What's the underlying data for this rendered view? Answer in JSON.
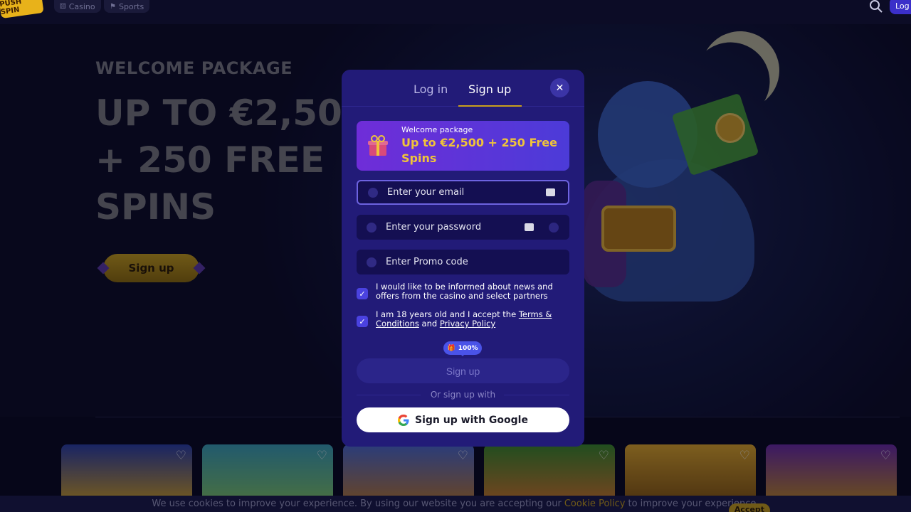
{
  "topbar": {
    "logo_text": "PUSH SPIN",
    "nav": [
      {
        "label": "Casino",
        "icon": "dice-icon"
      },
      {
        "label": "Sports",
        "icon": "trophy-icon"
      }
    ],
    "login_label": "Log"
  },
  "hero": {
    "subtitle": "WELCOME PACKAGE",
    "title": "UP TO €2,50\n+ 250 FREE\nSPINS",
    "signup_label": "Sign up"
  },
  "modal": {
    "tabs": [
      "Log in",
      "Sign up"
    ],
    "active_tab": "Sign up",
    "banner": {
      "small": "Welcome package",
      "big": "Up to €2,500 + 250 Free Spins"
    },
    "email_placeholder": "Enter your email",
    "password_placeholder": "Enter your password",
    "promo_placeholder": "Enter Promo code",
    "check_news": "I would like to be informed about news and offers from the casino and select partners",
    "check_age_prefix": "I am 18 years old and I accept the ",
    "check_age_terms": "Terms & Conditions",
    "check_age_and": " and ",
    "check_age_privacy": "Privacy Policy",
    "bonus_badge": "100%",
    "submit_label": "Sign up",
    "or_text": "Or sign up with",
    "google_label": "Sign up with Google"
  },
  "cookie": {
    "text_before": "We use cookies to improve your experience. By using our website you are accepting our",
    "policy_link": "Cookie Policy",
    "text_after": "to improve your experience.",
    "accept_label": "Accept"
  },
  "colors": {
    "modal_bg": "#221b78",
    "accent_gold": "#c9a01c",
    "checkbox": "#4a42e0"
  }
}
